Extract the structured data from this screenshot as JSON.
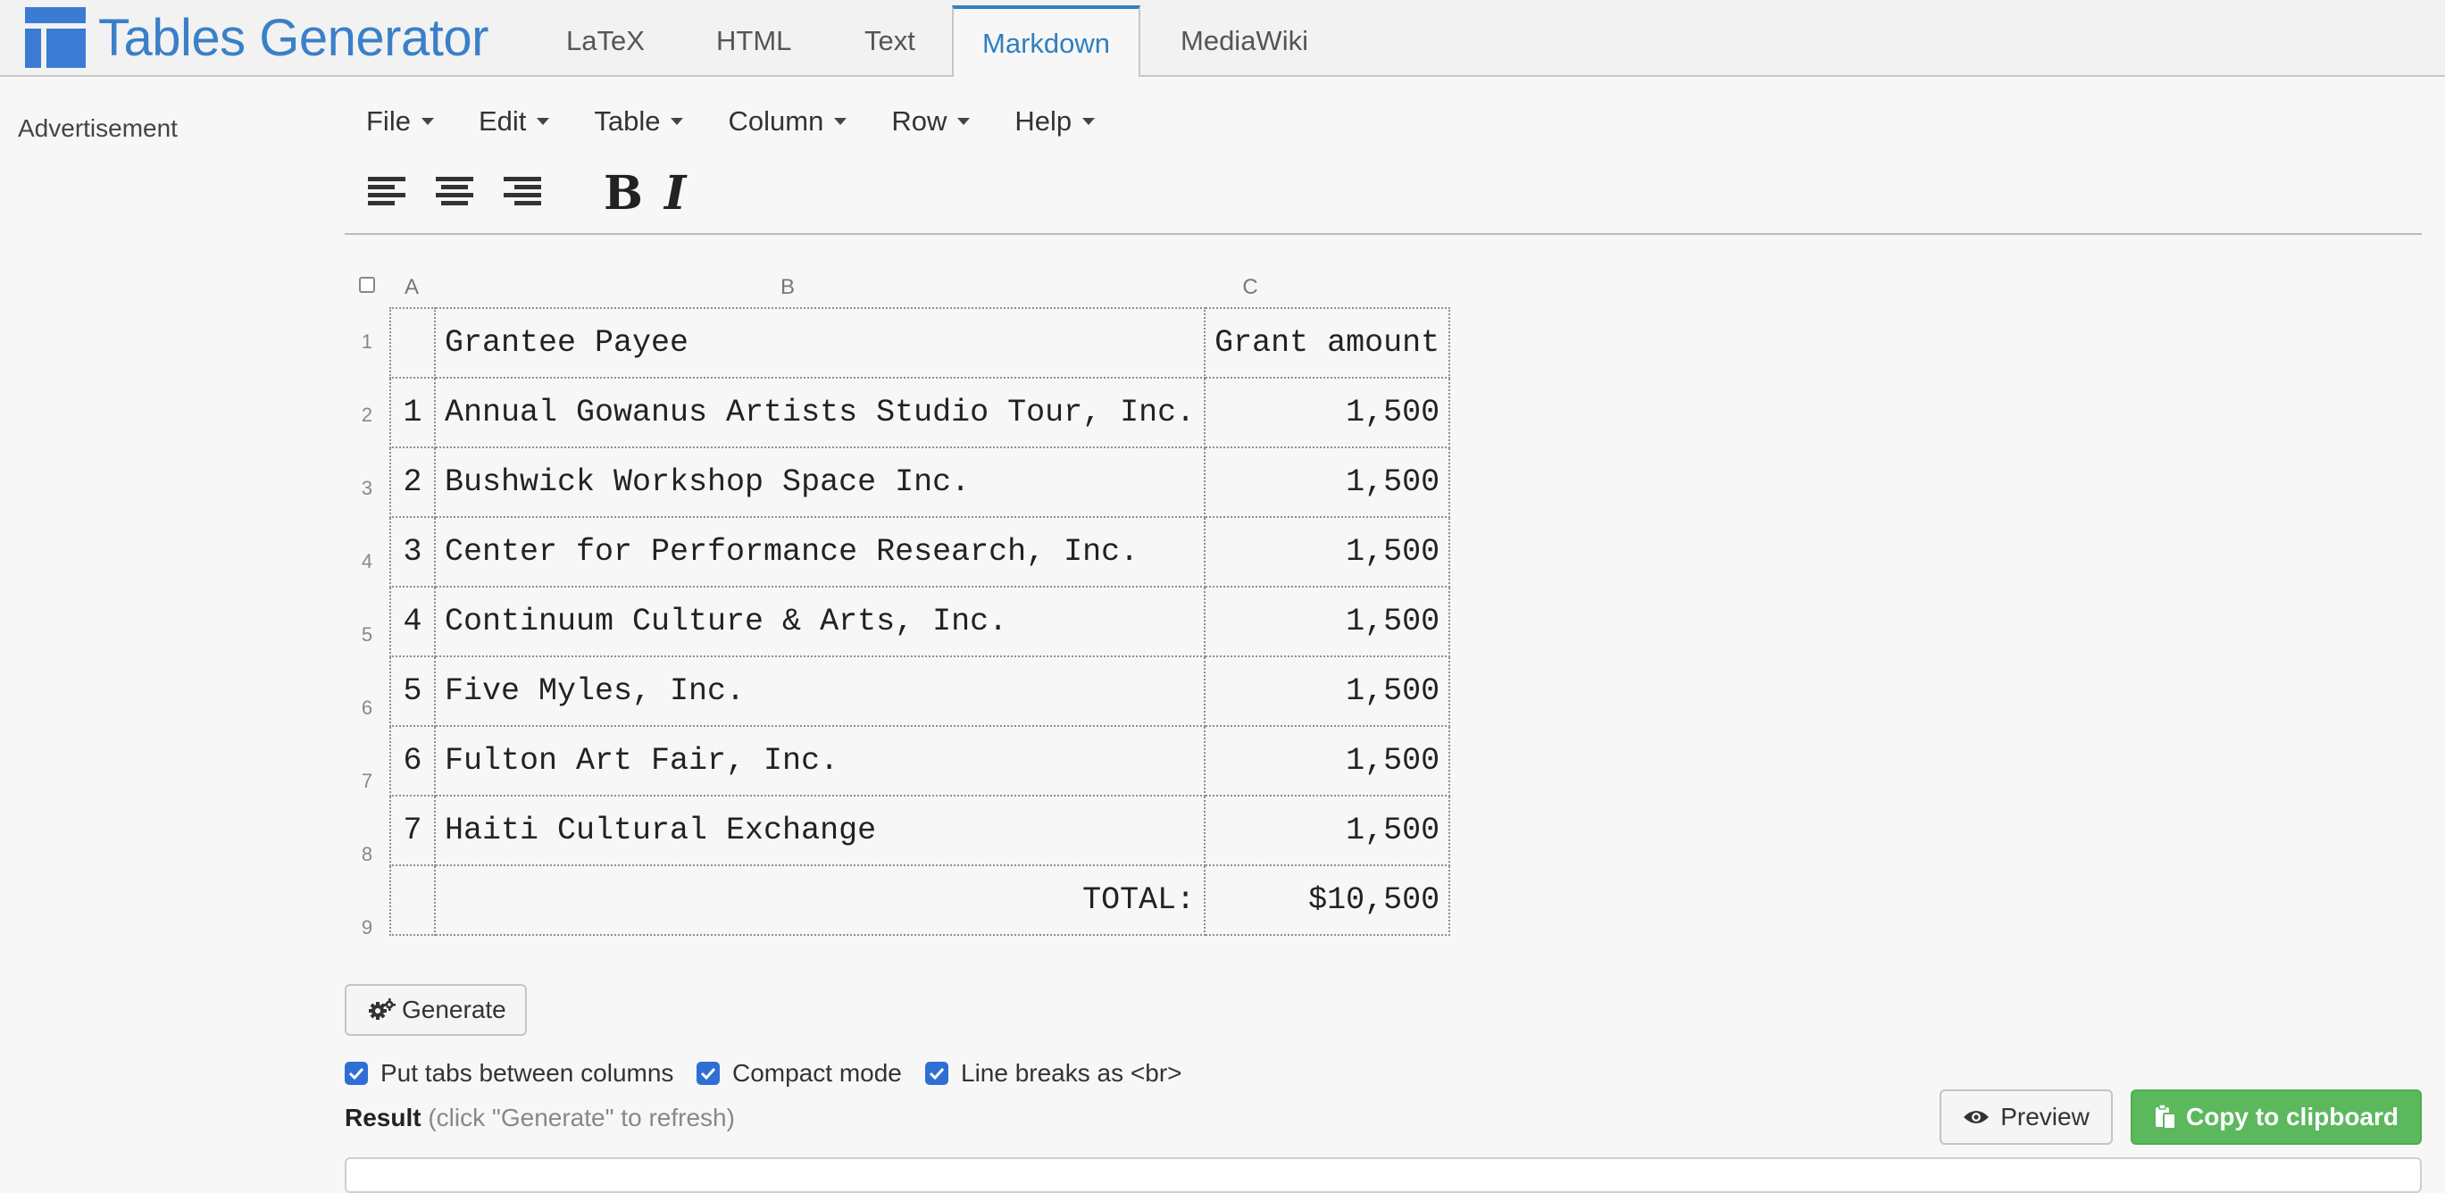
{
  "app": {
    "title": "Tables Generator"
  },
  "nav": {
    "tabs": [
      {
        "label": "LaTeX"
      },
      {
        "label": "HTML"
      },
      {
        "label": "Text"
      },
      {
        "label": "Markdown",
        "active": true
      },
      {
        "label": "MediaWiki"
      }
    ]
  },
  "sidebar": {
    "advert": "Advertisement"
  },
  "menu": {
    "items": [
      {
        "label": "File"
      },
      {
        "label": "Edit"
      },
      {
        "label": "Table"
      },
      {
        "label": "Column"
      },
      {
        "label": "Row"
      },
      {
        "label": "Help"
      }
    ]
  },
  "format_toolbar": {
    "icons": [
      "align-left-icon",
      "align-center-icon",
      "align-right-icon"
    ],
    "bold": "B",
    "italic": "I"
  },
  "grid": {
    "columns": [
      "A",
      "B",
      "C"
    ],
    "row_numbers": [
      "1",
      "2",
      "3",
      "4",
      "5",
      "6",
      "7",
      "8",
      "9"
    ],
    "rows": [
      {
        "a": "",
        "b": "Grantee Payee",
        "c": "Grant amount"
      },
      {
        "a": "1",
        "b": "Annual Gowanus Artists Studio Tour, Inc.",
        "c": "1,500"
      },
      {
        "a": "2",
        "b": "Bushwick Workshop Space Inc.",
        "c": "1,500"
      },
      {
        "a": "3",
        "b": "Center for Performance Research, Inc.",
        "c": "1,500"
      },
      {
        "a": "4",
        "b": "Continuum Culture & Arts, Inc.",
        "c": "1,500"
      },
      {
        "a": "5",
        "b": "Five Myles, Inc.",
        "c": "1,500"
      },
      {
        "a": "6",
        "b": "Fulton Art Fair, Inc.",
        "c": "1,500"
      },
      {
        "a": "7",
        "b": "Haiti Cultural Exchange",
        "c": "1,500"
      },
      {
        "a": "",
        "b": "TOTAL:",
        "c": "$10,500"
      }
    ]
  },
  "actions": {
    "generate": "Generate",
    "options": [
      {
        "label": "Put tabs between columns",
        "checked": true
      },
      {
        "label": "Compact mode",
        "checked": true
      },
      {
        "label": "Line breaks as <br>",
        "checked": true
      }
    ],
    "result_label": "Result",
    "result_hint": "(click \"Generate\" to refresh)",
    "preview": "Preview",
    "copy": "Copy to clipboard"
  },
  "colors": {
    "accent": "#2f7fc2",
    "logo": "#3b7bd4",
    "copy_button": "#5cb85c",
    "checkbox": "#2f6fd4"
  }
}
